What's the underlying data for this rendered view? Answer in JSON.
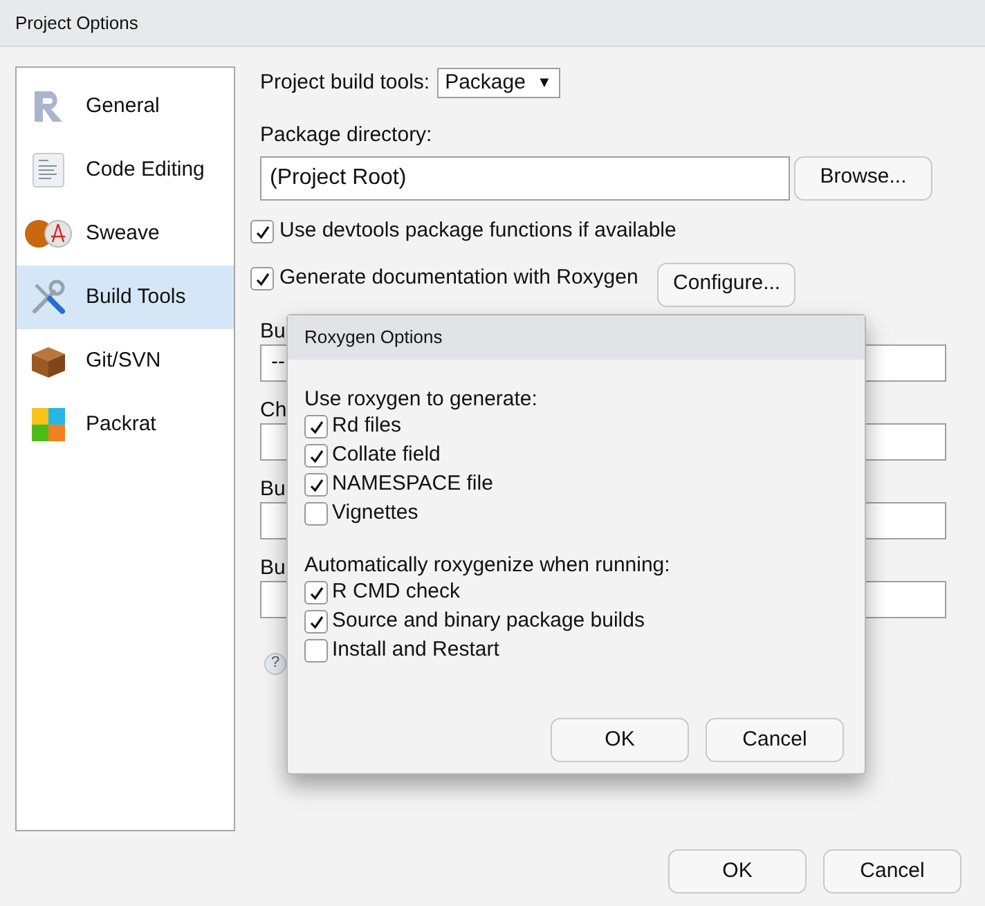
{
  "window": {
    "title": "Project Options"
  },
  "sidebar": {
    "items": [
      {
        "label": "General",
        "selected": false
      },
      {
        "label": "Code Editing",
        "selected": false
      },
      {
        "label": "Sweave",
        "selected": false
      },
      {
        "label": "Build Tools",
        "selected": true
      },
      {
        "label": "Git/SVN",
        "selected": false
      },
      {
        "label": "Packrat",
        "selected": false
      }
    ]
  },
  "build_tools": {
    "label": "Project build tools:",
    "value": "Package",
    "caret": "▼"
  },
  "package_directory": {
    "label": "Package directory:",
    "value": "(Project Root)",
    "button": "Browse..."
  },
  "options": [
    {
      "label": "Use devtools package functions if available",
      "checked": true
    },
    {
      "label": "Generate documentation with Roxygen",
      "checked": true,
      "button": "Configure..."
    }
  ],
  "background_fields": [
    {
      "label": "Bu",
      "value": "--"
    },
    {
      "label": "Ch"
    },
    {
      "label": "Bu"
    },
    {
      "label": "Bu"
    }
  ],
  "help": "?",
  "buttons": [
    "OK",
    "Cancel"
  ],
  "roxygen_dialog": {
    "title": "Roxygen Options",
    "groups": [
      {
        "heading": "Use roxygen to generate:",
        "items": [
          {
            "label": "Rd files",
            "checked": true
          },
          {
            "label": "Collate field",
            "checked": true
          },
          {
            "label": "NAMESPACE file",
            "checked": true
          },
          {
            "label": "Vignettes",
            "checked": false
          }
        ]
      },
      {
        "heading": "Automatically roxygenize when running:",
        "items": [
          {
            "label": "R CMD check",
            "checked": true
          },
          {
            "label": "Source and binary package builds",
            "checked": true
          },
          {
            "label": "Install and Restart",
            "checked": false
          }
        ]
      }
    ],
    "buttons": [
      "OK",
      "Cancel"
    ]
  }
}
